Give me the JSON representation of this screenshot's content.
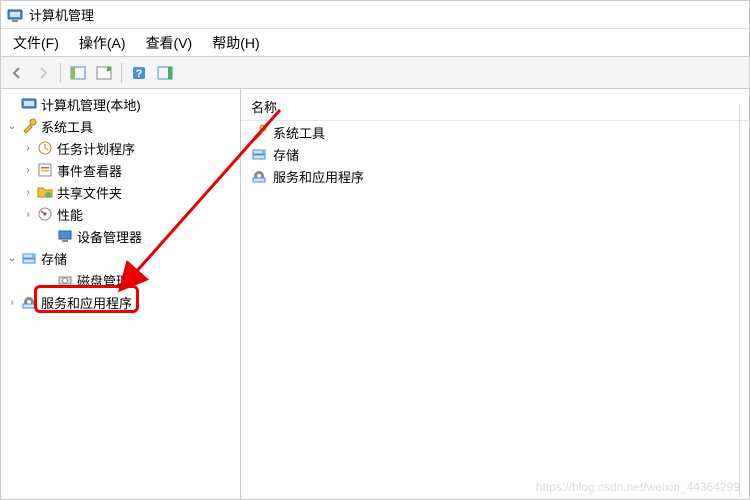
{
  "window": {
    "title": "计算机管理"
  },
  "menu": {
    "file": "文件(F)",
    "action": "操作(A)",
    "view": "查看(V)",
    "help": "帮助(H)"
  },
  "tree": {
    "root": "计算机管理(本地)",
    "system_tools": "系统工具",
    "task_scheduler": "任务计划程序",
    "event_viewer": "事件查看器",
    "shared_folders": "共享文件夹",
    "performance": "性能",
    "device_manager": "设备管理器",
    "storage": "存储",
    "disk_management": "磁盘管理",
    "services_apps": "服务和应用程序"
  },
  "right": {
    "header": "名称",
    "items": {
      "system_tools": "系统工具",
      "storage": "存储",
      "services_apps": "服务和应用程序"
    }
  },
  "watermark": "https://blog.csdn.net/weixin_44364299"
}
